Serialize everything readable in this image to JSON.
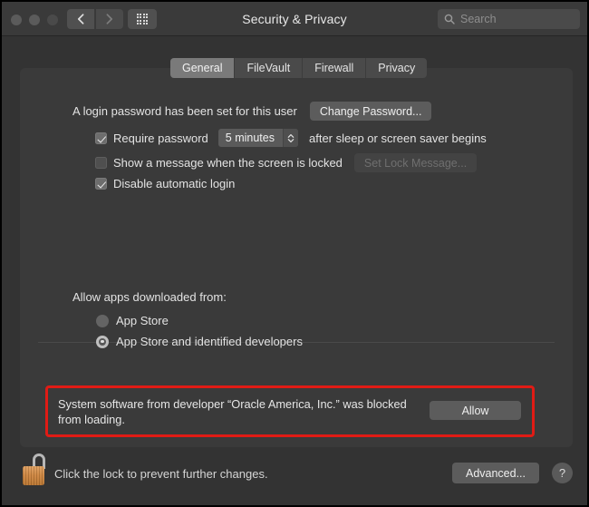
{
  "window": {
    "title": "Security & Privacy",
    "traffic_lights": [
      "close",
      "minimize",
      "maximize"
    ],
    "nav": {
      "back_icon": "chevron-left-icon",
      "forward_icon": "chevron-right-icon",
      "grid_icon": "show-all-grid-icon"
    },
    "search": {
      "placeholder": "Search",
      "value": "",
      "icon": "search-icon"
    }
  },
  "tabs": [
    {
      "label": "General",
      "active": true
    },
    {
      "label": "FileVault",
      "active": false
    },
    {
      "label": "Firewall",
      "active": false
    },
    {
      "label": "Privacy",
      "active": false
    }
  ],
  "general": {
    "login_password_text": "A login password has been set for this user",
    "change_password_label": "Change Password...",
    "require_password": {
      "checked": true,
      "label": "Require password",
      "delay_value": "5 minutes",
      "suffix": "after sleep or screen saver begins",
      "stepper_icon": "stepper-up-down-icon"
    },
    "show_message": {
      "checked": false,
      "label": "Show a message when the screen is locked",
      "button_label": "Set Lock Message...",
      "button_disabled": true
    },
    "disable_auto_login": {
      "checked": true,
      "label": "Disable automatic login"
    },
    "allow_apps_heading": "Allow apps downloaded from:",
    "allow_apps_options": [
      {
        "label": "App Store",
        "selected": false
      },
      {
        "label": "App Store and identified developers",
        "selected": true
      }
    ],
    "blocked_alert": {
      "message": "System software from developer “Oracle America, Inc.” was blocked from loading.",
      "allow_label": "Allow",
      "highlight_color": "#e01b15"
    }
  },
  "footer": {
    "lock_icon": "unlocked-padlock-icon",
    "lock_caption": "Click the lock to prevent further changes.",
    "advanced_label": "Advanced...",
    "help_label": "?"
  }
}
